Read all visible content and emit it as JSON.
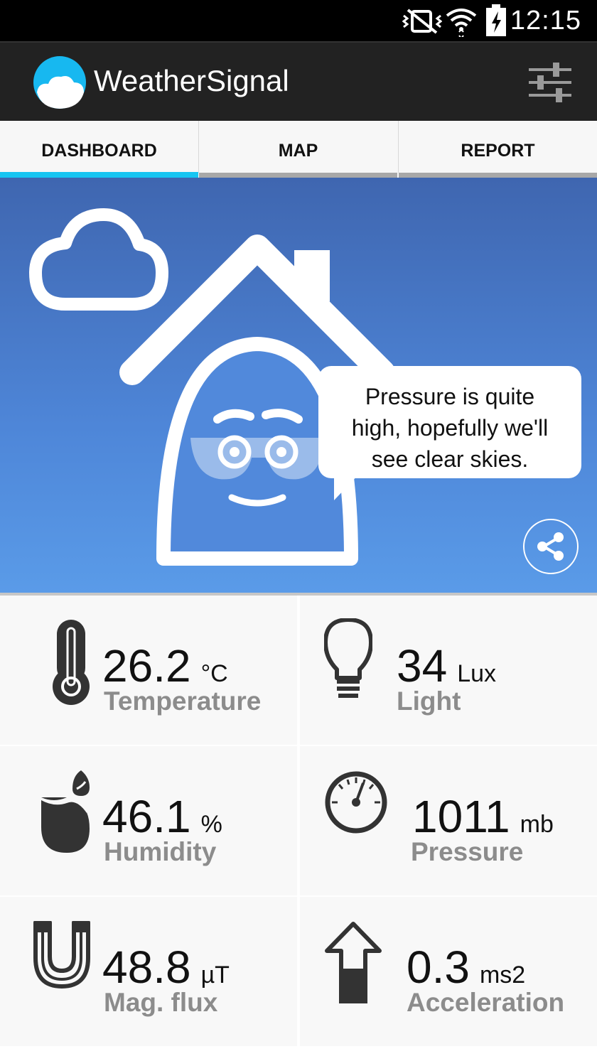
{
  "status_bar": {
    "time": "12:15",
    "icons": [
      "vibrate-mute-icon",
      "wifi-icon",
      "battery-charging-icon"
    ]
  },
  "app": {
    "title": "WeatherSignal",
    "logo_icon": "weathersignal-cloud-logo-icon",
    "settings_icon": "sliders-settings-icon"
  },
  "tabs": [
    {
      "label": "DASHBOARD",
      "active": true
    },
    {
      "label": "MAP",
      "active": false
    },
    {
      "label": "REPORT",
      "active": false
    }
  ],
  "hero": {
    "message": "Pressure is quite high, hopefully we'll see clear skies.",
    "message_lines": [
      "Pressure is quite",
      "high, hopefully we'll",
      "see clear skies."
    ],
    "share_icon": "share-icon"
  },
  "sensors": [
    {
      "value": "26.2",
      "unit": "°C",
      "label": "Temperature",
      "icon": "thermometer-icon"
    },
    {
      "value": "34",
      "unit": "Lux",
      "label": "Light",
      "icon": "lightbulb-icon"
    },
    {
      "value": "46.1",
      "unit": "%",
      "label": "Humidity",
      "icon": "water-drops-icon"
    },
    {
      "value": "1011",
      "unit": "mb",
      "label": "Pressure",
      "icon": "gauge-icon"
    },
    {
      "value": "48.8",
      "unit": "µT",
      "label": "Mag. flux",
      "icon": "magnet-icon"
    },
    {
      "value": "0.3",
      "unit": "ms2",
      "label": "Acceleration",
      "icon": "arrow-up-icon"
    }
  ],
  "colors": {
    "accent": "#17c5f2",
    "hero_top": "#3f66b0",
    "hero_bottom": "#5a9be8",
    "actionbar": "#222222",
    "label_gray": "#8c8c8c"
  }
}
